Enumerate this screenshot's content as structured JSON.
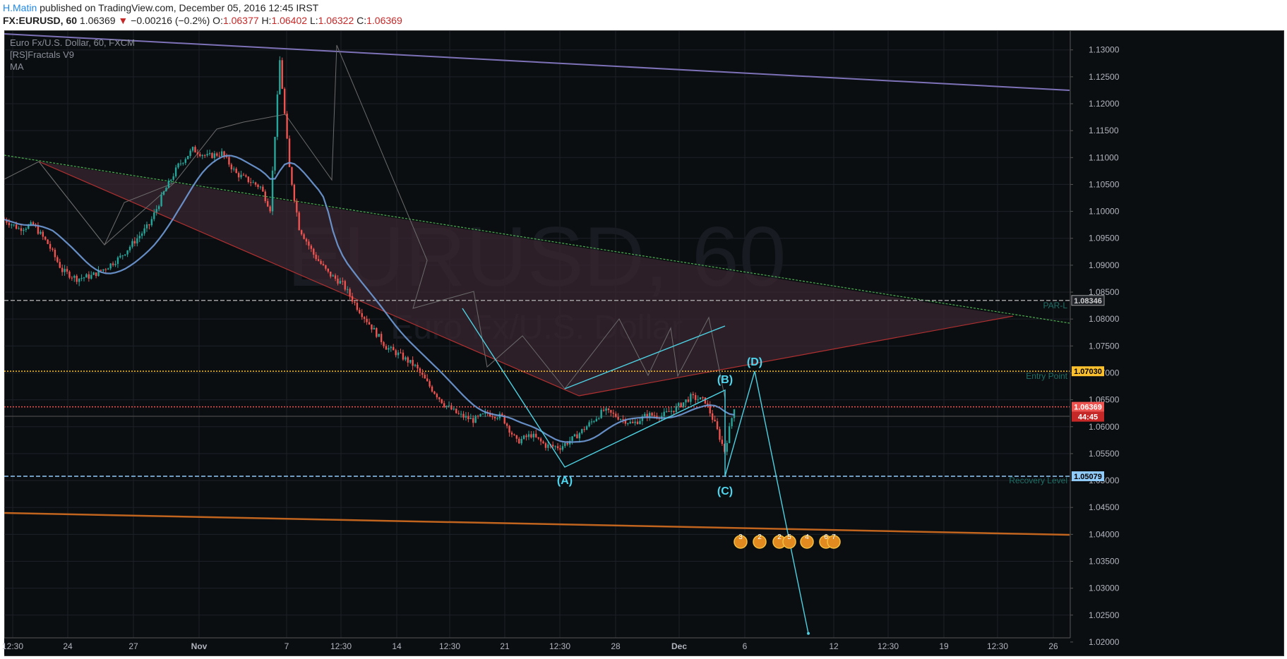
{
  "header": {
    "author": "H.Matin",
    "published_text": " published on TradingView.com, December 05, 2016 12:45 IRST",
    "symbol_interval": "FX:EURUSD, 60",
    "last": "1.06369",
    "change": "−0.00216 (−0.2%)",
    "o_label": "O:",
    "o": "1.06377",
    "h_label": "H:",
    "h": "1.06402",
    "l_label": "L:",
    "l": "1.06322",
    "c_label": "C:",
    "c": "1.06369"
  },
  "legend": {
    "series": "Euro Fx/U.S. Dollar, 60, FXCM",
    "indicator1": "[RS]Fractals V9",
    "indicator2": "MA"
  },
  "watermark": {
    "main": "EURUSD, 60",
    "sub": "Euro Fx/U.S. Dollar"
  },
  "colors": {
    "background": "#0b0e11",
    "grid": "#1c2128",
    "bull_candle": "#26a69a",
    "bear_candle": "#ef5350",
    "ma_line": "#6f9bd8",
    "pattern_line": "#4dd0e1",
    "channel_fill": "#3a2530",
    "upper_trend": "#4caf50",
    "lower_trend": "#b03030",
    "top_line": "#7d72b8",
    "bottom_line": "#c0641e"
  },
  "chart_data": {
    "type": "candlestick",
    "symbol": "FX:EURUSD",
    "interval": "60",
    "ylim": [
      1.0175,
      1.1335
    ],
    "y_ticks": [
      "1.13000",
      "1.12500",
      "1.12000",
      "1.11500",
      "1.11000",
      "1.10500",
      "1.10000",
      "1.09500",
      "1.09000",
      "1.08500",
      "1.08000",
      "1.07500",
      "1.07000",
      "1.06500",
      "1.06000",
      "1.05500",
      "1.05000",
      "1.04500",
      "1.04000",
      "1.03500",
      "1.03000",
      "1.02500",
      "1.02000"
    ],
    "x_ticks": [
      "12:30",
      "24",
      "27",
      "Nov",
      "7",
      "12:30",
      "14",
      "12:30",
      "21",
      "12:30",
      "28",
      "Dec",
      "6",
      "12",
      "12:30",
      "19",
      "12:30",
      "26"
    ],
    "price_levels": [
      {
        "label": "PAR-L",
        "value": 1.08346,
        "tag": "1.08346",
        "color": "#9e9e9e",
        "style": "dashed"
      },
      {
        "label": "Entry Point",
        "value": 1.0703,
        "tag": "1.07030",
        "color": "#fbc02d",
        "style": "dotted"
      },
      {
        "label": "",
        "value": 1.06369,
        "tag": "1.06369",
        "color": "#ef5350",
        "style": "dotted"
      },
      {
        "label": "Recovery Level",
        "value": 1.05079,
        "tag": "1.05079",
        "color": "#90caf9",
        "style": "dashed"
      }
    ],
    "countdown": "44:45",
    "pattern_points": [
      {
        "label": "(A)",
        "value": 1.0525
      },
      {
        "label": "(B)",
        "value": 1.0668
      },
      {
        "label": "(C)",
        "value": 1.0508
      },
      {
        "label": "(D)",
        "value": 1.0703
      },
      {
        "label": "",
        "value": 1.0216
      }
    ],
    "event_icons": [
      "3",
      "2",
      "2",
      "5",
      "4",
      "6",
      "7"
    ],
    "close_path": [
      [
        0,
        1.0985
      ],
      [
        6,
        1.0968
      ],
      [
        12,
        1.0975
      ],
      [
        18,
        1.094
      ],
      [
        24,
        1.089
      ],
      [
        30,
        1.0875
      ],
      [
        36,
        1.088
      ],
      [
        42,
        1.0895
      ],
      [
        48,
        1.0915
      ],
      [
        54,
        1.0945
      ],
      [
        60,
        1.0975
      ],
      [
        66,
        1.1035
      ],
      [
        72,
        1.1085
      ],
      [
        78,
        1.1115
      ],
      [
        84,
        1.1102
      ],
      [
        90,
        1.1108
      ],
      [
        96,
        1.107
      ],
      [
        102,
        1.1055
      ],
      [
        106,
        1.1045
      ],
      [
        110,
        1.1005
      ],
      [
        114,
        1.128
      ],
      [
        118,
        1.108
      ],
      [
        122,
        1.097
      ],
      [
        128,
        1.092
      ],
      [
        134,
        1.0885
      ],
      [
        140,
        1.0865
      ],
      [
        146,
        1.0822
      ],
      [
        152,
        1.0785
      ],
      [
        158,
        1.0748
      ],
      [
        164,
        1.0732
      ],
      [
        170,
        1.0712
      ],
      [
        176,
        1.0675
      ],
      [
        182,
        1.0642
      ],
      [
        188,
        1.0622
      ],
      [
        194,
        1.0612
      ],
      [
        200,
        1.0625
      ],
      [
        206,
        1.0618
      ],
      [
        212,
        1.0572
      ],
      [
        218,
        1.0585
      ],
      [
        224,
        1.0565
      ],
      [
        230,
        1.0562
      ],
      [
        236,
        1.058
      ],
      [
        242,
        1.0605
      ],
      [
        248,
        1.063
      ],
      [
        254,
        1.0618
      ],
      [
        260,
        1.0605
      ],
      [
        266,
        1.0622
      ],
      [
        272,
        1.062
      ],
      [
        278,
        1.0635
      ],
      [
        284,
        1.0655
      ],
      [
        290,
        1.0648
      ],
      [
        294,
        1.0605
      ],
      [
        298,
        1.0555
      ],
      [
        302,
        1.0637
      ]
    ]
  }
}
